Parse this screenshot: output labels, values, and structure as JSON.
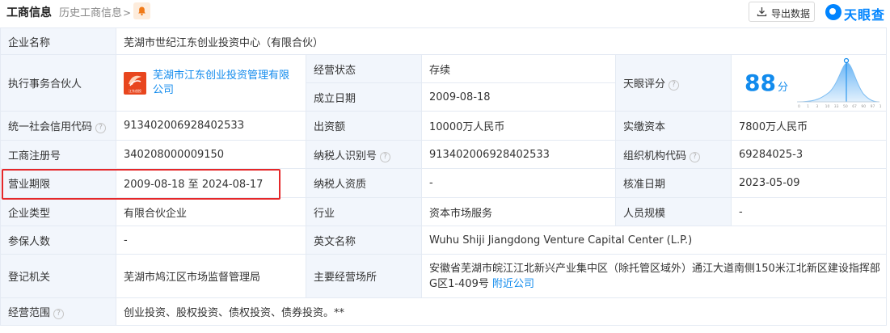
{
  "header": {
    "title": "工商信息",
    "history_link": "历史工商信息",
    "history_chevron": ">",
    "export_label": "导出数据",
    "brand": "天眼查"
  },
  "row1": {
    "label": "企业名称",
    "value": "芜湖市世纪江东创业投资中心（有限合伙）"
  },
  "partner": {
    "label": "执行事务合伙人",
    "name": "芜湖市江东创业投资管理有限公司",
    "logo_text": "江东创投",
    "status_label": "经营状态",
    "status_value": "存续",
    "founded_label": "成立日期",
    "founded_value": "2009-08-18",
    "score_label": "天眼评分",
    "score_value": "88",
    "score_unit": "分",
    "score_axis": [
      "0",
      "1",
      "3",
      "10",
      "33",
      "50",
      "67",
      "90",
      "97",
      "100"
    ]
  },
  "row3": {
    "credit_label": "统一社会信用代码",
    "credit_value": "91340200692840253З",
    "capital_label": "出资额",
    "capital_value": "10000万人民币",
    "paid_label": "实缴资本",
    "paid_value": "7800万人民币"
  },
  "row4": {
    "reg_label": "工商注册号",
    "reg_value": "340208000009150",
    "tax_label": "纳税人识别号",
    "tax_value": "913402006928402533",
    "org_label": "组织机构代码",
    "org_value": "69284025-3"
  },
  "row5": {
    "term_label": "营业期限",
    "term_value": "2009-08-18 至 2024-08-17",
    "taxq_label": "纳税人资质",
    "taxq_value": "-",
    "approve_label": "核准日期",
    "approve_value": "2023-05-09"
  },
  "row6": {
    "type_label": "企业类型",
    "type_value": "有限合伙企业",
    "industry_label": "行业",
    "industry_value": "资本市场服务",
    "staff_label": "人员规模",
    "staff_value": "-"
  },
  "row7": {
    "insured_label": "参保人数",
    "insured_value": "-",
    "en_label": "英文名称",
    "en_value": "Wuhu Shiji Jiangdong Venture Capital Center (L.P.)"
  },
  "row8": {
    "authority_label": "登记机关",
    "authority_value": "芜湖市鸠江区市场监督管理局",
    "address_label": "主要经营场所",
    "address_value": "安徽省芜湖市皖江江北新兴产业集中区（除托管区域外）通江大道南侧150米江北新区建设指挥部G区1-409号",
    "nearby_link": "附近公司"
  },
  "row9": {
    "scope_label": "经营范围",
    "scope_value": "创业投资、股权投资、债权投资、债券投资。**"
  },
  "colors": {
    "accent": "#128bed",
    "status": "#009944",
    "highlight": "#e5282a",
    "label_bg": "#f2f6fc"
  }
}
